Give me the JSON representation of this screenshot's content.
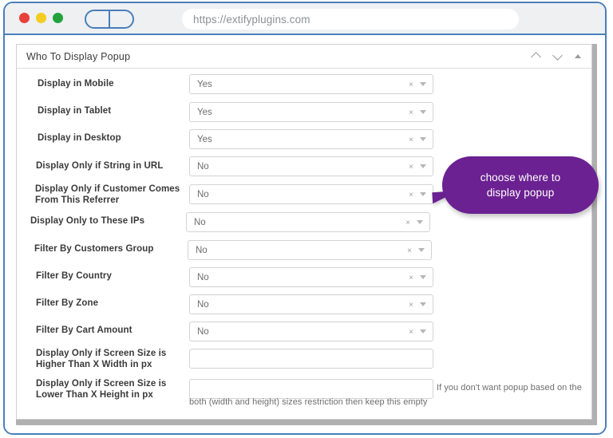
{
  "browser": {
    "url": "https://extifyplugins.com",
    "traffic_lights": [
      "close-red",
      "minimize-yellow",
      "maximize-green"
    ],
    "sidebar_toggle_icon": "panel-toggle-icon"
  },
  "panel": {
    "title": "Who To Display Popup",
    "header_icons": [
      "chevron-up-icon",
      "chevron-down-icon",
      "collapse-triangle-icon"
    ]
  },
  "fields": [
    {
      "label": "Display in Mobile",
      "type": "select",
      "value": "Yes"
    },
    {
      "label": "Display in Tablet",
      "type": "select",
      "value": "Yes"
    },
    {
      "label": "Display in Desktop",
      "type": "select",
      "value": "Yes"
    },
    {
      "label": "Display Only if String in URL",
      "type": "select",
      "value": "No"
    },
    {
      "label": "Display Only if Customer Comes From This Referrer",
      "type": "select",
      "value": "No"
    },
    {
      "label": "Display Only to These IPs",
      "type": "select",
      "value": "No"
    },
    {
      "label": "Filter By Customers Group",
      "type": "select",
      "value": "No"
    },
    {
      "label": "Filter By Country",
      "type": "select",
      "value": "No"
    },
    {
      "label": "Filter By Zone",
      "type": "select",
      "value": "No"
    },
    {
      "label": "Filter By Cart Amount",
      "type": "select",
      "value": "No"
    },
    {
      "label": "Display Only if Screen Size is Higher Than X Width in px",
      "type": "text",
      "value": ""
    },
    {
      "label": "Display Only if Screen Size is Lower Than X Height in px",
      "type": "text",
      "value": ""
    }
  ],
  "labels": {
    "f0": "Display in Mobile",
    "f1": "Display in Tablet",
    "f2": "Display in Desktop",
    "f3": "Display Only if String in URL",
    "f4a": "Display Only if Customer Comes",
    "f4b": "From This Referrer",
    "f5": "Display Only to These IPs",
    "f6": "Filter By Customers Group",
    "f7": "Filter By Country",
    "f8": "Filter By Zone",
    "f9": "Filter By Cart Amount",
    "f10a": "Display Only if Screen Size is",
    "f10b": "Higher Than X Width in px",
    "f11a": "Display Only if Screen Size is",
    "f11b": "Lower Than X Height in px"
  },
  "values": {
    "v0": "Yes",
    "v1": "Yes",
    "v2": "Yes",
    "v3": "No",
    "v4": "No",
    "v5": "No",
    "v6": "No",
    "v7": "No",
    "v8": "No",
    "v9": "No"
  },
  "select_icons": {
    "clear": "×",
    "caret": "chevron-down-icon"
  },
  "hint": {
    "line1": "If you don't want popup based on the",
    "line2": "both (width and height) sizes restriction then keep this empty"
  },
  "callout": {
    "line1": "choose where to",
    "line2": "display popup",
    "color": "#6B2191"
  }
}
